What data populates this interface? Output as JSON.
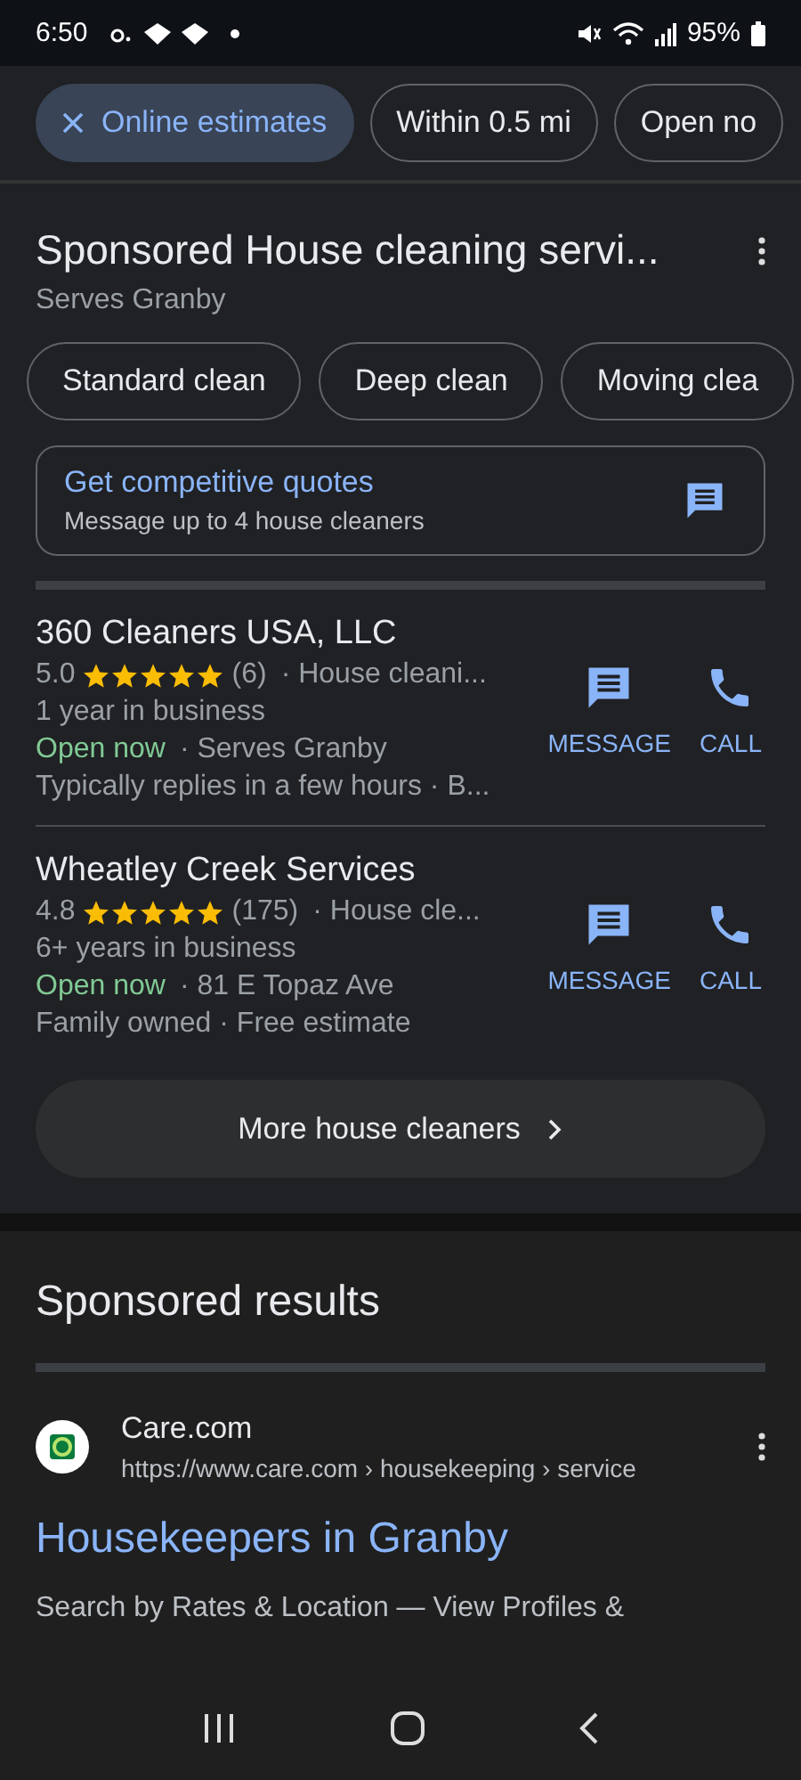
{
  "status_bar": {
    "time": "6:50",
    "battery": "95%"
  },
  "filters": [
    {
      "label": "Online estimates",
      "selected": true
    },
    {
      "label": "Within 0.5 mi",
      "selected": false
    },
    {
      "label": "Open no",
      "selected": false
    }
  ],
  "section": {
    "title": "Sponsored House cleaning servi...",
    "subtitle": "Serves Granby",
    "chips": [
      "Standard clean",
      "Deep clean",
      "Moving clea"
    ],
    "quotes": {
      "title": "Get competitive quotes",
      "subtitle": "Message up to 4 house cleaners"
    },
    "listings": [
      {
        "name": "360 Cleaners USA, LLC",
        "rating": "5.0",
        "stars": 5,
        "reviews": "(6)",
        "category": "· House cleani...",
        "years": "1 year in business",
        "open": "Open now",
        "location": "· Serves Granby",
        "extra": "Typically replies in a few hours · B...",
        "message": "MESSAGE",
        "call": "CALL"
      },
      {
        "name": "Wheatley Creek Services",
        "rating": "4.8",
        "stars": 5,
        "reviews": "(175)",
        "category": "· House cle...",
        "years": "6+ years in business",
        "open": "Open now",
        "location": "· 81 E Topaz Ave",
        "extra": "Family owned · Free estimate",
        "message": "MESSAGE",
        "call": "CALL"
      }
    ],
    "more": "More house cleaners"
  },
  "sponsored": {
    "title": "Sponsored results",
    "site": "Care.com",
    "url": "https://www.care.com › housekeeping › service",
    "headline": "Housekeepers in Granby",
    "snippet": "Search by Rates & Location — View Profiles &"
  }
}
